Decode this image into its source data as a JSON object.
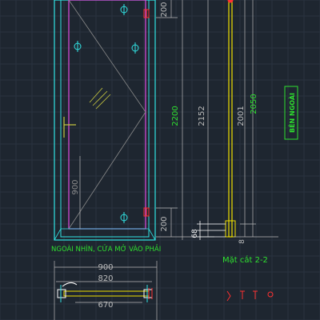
{
  "drawing": {
    "colors": {
      "background": "#1e2630",
      "grid": "#2a3440",
      "frame_cyan": "#31e3e3",
      "panel_magenta": "#e04ae0",
      "glass_grey": "#8a8a8a",
      "dim_grey": "#b8b8b8",
      "text_green": "#2fe02f",
      "text_grey": "#bdbdbd",
      "yellow": "#f0e000",
      "hardware_red": "#ff3030"
    },
    "elevation_caption": "NGOÀI NHÌN, CỬA MỞ VÀO PHẢI",
    "section_title": "Mặt cắt 2-2",
    "outside_label": "BÊN NGOÀI",
    "elevation_dims": {
      "top_200": "200",
      "bottom_200": "200",
      "handle_900": "900",
      "overall_2200": "2200",
      "inner_2152": "2152"
    },
    "section_dims": {
      "height_2001": "2001",
      "height_2050": "2050",
      "base_68": "68",
      "base_8": "8"
    },
    "plan_dims": {
      "width_820": "820",
      "width_670": "670",
      "top_dim": "900"
    }
  }
}
